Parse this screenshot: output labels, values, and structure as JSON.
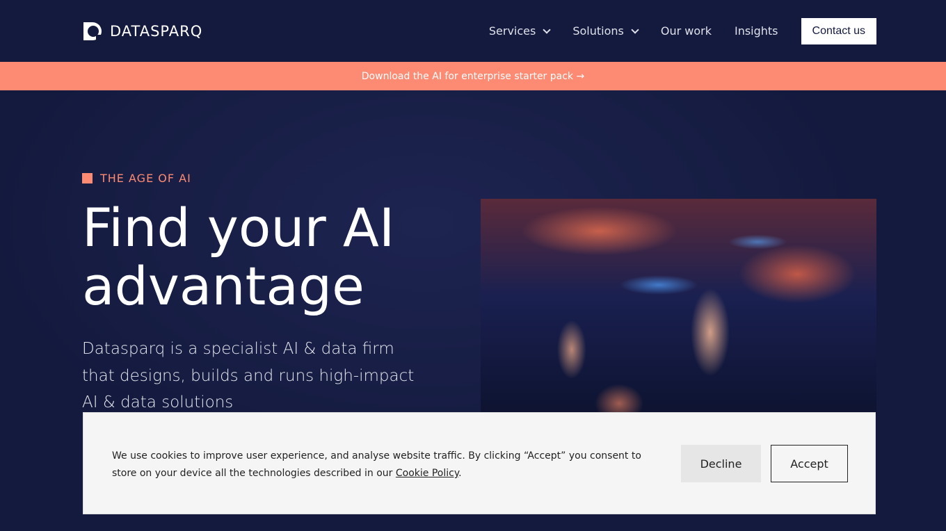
{
  "nav": {
    "brand": "DATASPARQ",
    "items": [
      {
        "label": "Services",
        "dropdown": true
      },
      {
        "label": "Solutions",
        "dropdown": true
      },
      {
        "label": "Our work"
      },
      {
        "label": "Insights"
      }
    ],
    "contact": "Contact us"
  },
  "banner": {
    "text": "Download the AI for enterprise starter pack →"
  },
  "hero": {
    "eyebrow": "THE AGE OF AI",
    "title": "Find your AI advantage",
    "description": "Datasparq is a specialist AI & data firm that designs, builds and runs high-impact AI & data solutions"
  },
  "cookie": {
    "text": "We use cookies to improve user experience, and analyse website traffic. By clicking “Accept” you consent to store on your device all the technologies described in our ",
    "link": "Cookie Policy",
    "after": ".",
    "decline": "Decline",
    "accept": "Accept"
  },
  "colors": {
    "background": "#141a3e",
    "accent": "#fd8a73"
  }
}
